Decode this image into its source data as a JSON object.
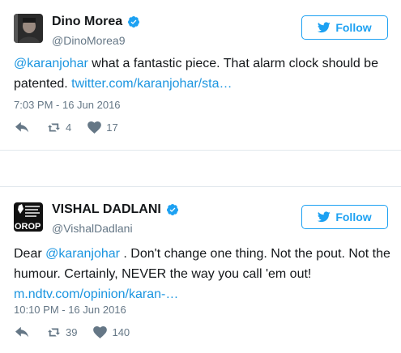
{
  "tweets": [
    {
      "name": "Dino Morea",
      "handle": "@DinoMorea9",
      "follow_label": "Follow",
      "text_mention": "@karanjohar",
      "text_body": " what a fantastic piece. That alarm clock should be patented. ",
      "text_link": "twitter.com/karanjohar/sta…",
      "timestamp": "7:03 PM - 16 Jun 2016",
      "retweets": "4",
      "likes": "17"
    },
    {
      "name": "VISHAL DADLANI",
      "handle": "@VishalDadlani",
      "follow_label": "Follow",
      "text_prefix": "Dear ",
      "text_mention": "@karanjohar",
      "text_body": " . Don't change one thing. Not the pout. Not the humour. Certainly, NEVER the way you call 'em out! ",
      "text_link": "m.ndtv.com/opinion/karan-…",
      "timestamp": "10:10 PM - 16 Jun 2016",
      "retweets": "39",
      "likes": "140",
      "avatar_text": "OROP"
    }
  ],
  "colors": {
    "accent": "#1da1f2",
    "link": "#1b95e0",
    "muted": "#657786"
  },
  "icons": [
    "verified-badge-icon",
    "twitter-bird-icon",
    "reply-icon",
    "retweet-icon",
    "heart-icon"
  ]
}
